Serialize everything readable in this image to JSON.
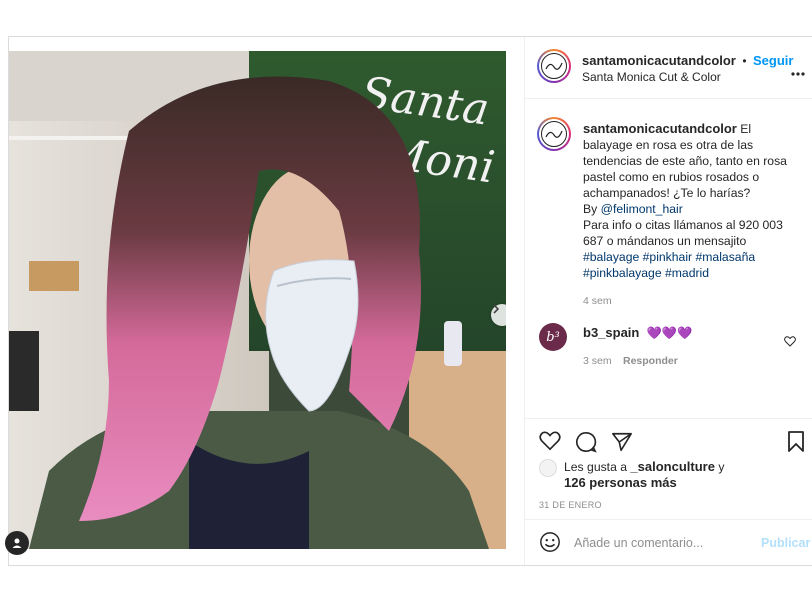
{
  "post": {
    "username": "santamonicacutandcolor",
    "follow_label": "Seguir",
    "dot": "•",
    "location": "Santa Monica Cut & Color",
    "media": {
      "sign_text": "Santa Monica",
      "carousel_count": 5,
      "carousel_active": 1
    },
    "caption": {
      "username": "santamonicacutandcolor",
      "text1": "El balayage en rosa es otra de las tendencias de este año, tanto en rosa pastel como en rubios rosados o achampanados! ¿Te lo harías?",
      "by": "By",
      "mention": "@felimont_hair",
      "text2": "Para info o citas llámanos al 920 003 687 o mándanos un mensajito",
      "hashtags": [
        "#balayage",
        "#pinkhair",
        "#malasaña",
        "#pinkbalayage",
        "#madrid"
      ],
      "time": "4 sem"
    },
    "comment": {
      "username": "b3_spain",
      "avatar_text": "b³",
      "hearts": "💜💜💜",
      "time": "3 sem",
      "reply_label": "Responder"
    },
    "likes": {
      "prefix": "Les gusta a",
      "user": "_salonculture",
      "suffix": "y",
      "others": "126 personas más"
    },
    "date": "31 DE ENERO",
    "add_comment_placeholder": "Añade un comentario...",
    "publish_label": "Publicar"
  },
  "colors": {
    "link_blue": "#0095f6",
    "hashtag": "#00376b",
    "muted": "#8e8e8e",
    "heart_purple": "#8a5cd0"
  },
  "icons": [
    "more-icon",
    "heart-icon",
    "comment-icon",
    "share-icon",
    "bookmark-icon",
    "emoji-icon",
    "next-arrow-icon",
    "user-tag-icon"
  ]
}
